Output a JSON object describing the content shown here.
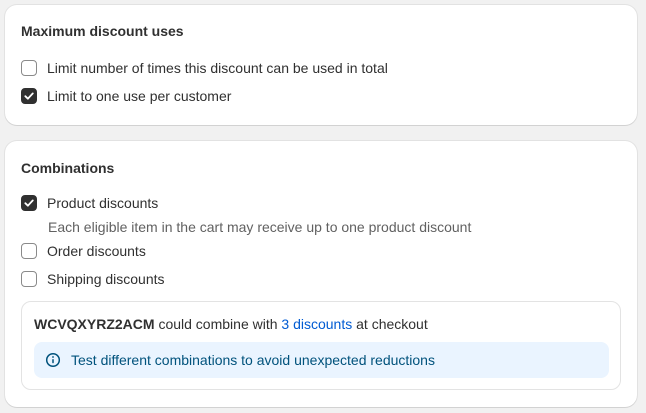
{
  "max_uses": {
    "title": "Maximum discount uses",
    "options": [
      {
        "label": "Limit number of times this discount can be used in total",
        "checked": false
      },
      {
        "label": "Limit to one use per customer",
        "checked": true
      }
    ]
  },
  "combinations": {
    "title": "Combinations",
    "options": [
      {
        "label": "Product discounts",
        "checked": true
      },
      {
        "label": "Order discounts",
        "checked": false
      },
      {
        "label": "Shipping discounts",
        "checked": false
      }
    ],
    "product_helper": "Each eligible item in the cart may receive up to one product discount",
    "summary": {
      "code": "WCVQXYRZ2ACM",
      "text_before_link": " could combine with ",
      "link": "3 discounts",
      "text_after_link": " at checkout"
    },
    "banner": {
      "icon": "info-icon",
      "text": "Test different combinations to avoid unexpected reductions"
    }
  }
}
